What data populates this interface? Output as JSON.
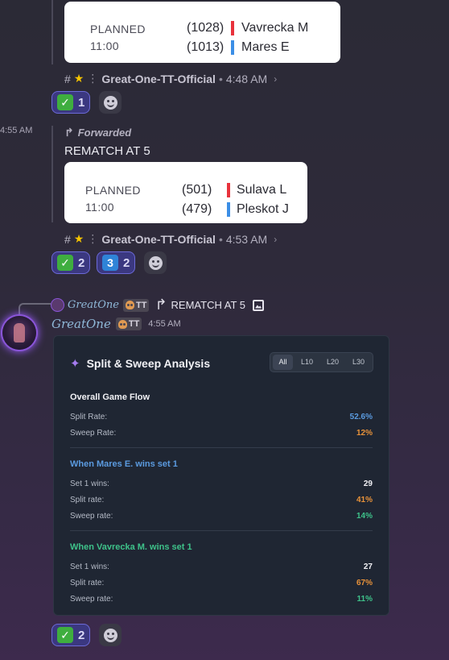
{
  "colors": {
    "red_bar": "#e8323c",
    "blue_bar": "#3b8ee6",
    "green_reaction": "#3fae3f",
    "blue_reaction": "#2f84d8",
    "accent_blue": "#5b9be0",
    "accent_orange": "#e8923a",
    "accent_green": "#3ec28a"
  },
  "messages": [
    {
      "match": {
        "status": "PLANNED",
        "time": "11:00",
        "p1_seed": "(1028)",
        "p1_name": "Vavrecka M",
        "p2_seed": "(1013)",
        "p2_name": "Mares E"
      },
      "channel_ref": {
        "channel": "Great-One-TT-Official",
        "timestamp": "4:48 AM"
      },
      "reactions": [
        {
          "emoji": "check-mark",
          "count": "1"
        }
      ]
    },
    {
      "side_time": "4:55 AM",
      "forwarded_label": "Forwarded",
      "text": "REMATCH AT 5",
      "match": {
        "status": "PLANNED",
        "time": "11:00",
        "p1_seed": "(501)",
        "p1_name": "Sulava L",
        "p2_seed": "(479)",
        "p2_name": "Pleskot J"
      },
      "channel_ref": {
        "channel": "Great-One-TT-Official",
        "timestamp": "4:53 AM"
      },
      "reactions": [
        {
          "emoji": "check-mark",
          "count": "2"
        },
        {
          "emoji": "keycap-three",
          "glyph": "3",
          "count": "2"
        }
      ]
    }
  ],
  "reply": {
    "author": "GreatOne",
    "badge": "TT",
    "text": "REMATCH AT 5"
  },
  "bot_message": {
    "author": "GreatOne",
    "badge": "TT",
    "timestamp": "4:55 AM",
    "reactions": [
      {
        "emoji": "check-mark",
        "count": "2"
      }
    ]
  },
  "analysis": {
    "title": "Split & Sweep Analysis",
    "filters": [
      "All",
      "L10",
      "L20",
      "L30"
    ],
    "active_filter": "All",
    "sections": [
      {
        "heading": "Overall Game Flow",
        "rows": [
          {
            "label": "Split Rate:",
            "value": "52.6%"
          },
          {
            "label": "Sweep Rate:",
            "value": "12%"
          }
        ]
      },
      {
        "heading": "When Mares E. wins set 1",
        "rows": [
          {
            "label": "Set 1 wins:",
            "value": "29"
          },
          {
            "label": "Split rate:",
            "value": "41%"
          },
          {
            "label": "Sweep rate:",
            "value": "14%"
          }
        ]
      },
      {
        "heading": "When Vavrecka M. wins set 1",
        "rows": [
          {
            "label": "Set 1 wins:",
            "value": "27"
          },
          {
            "label": "Split rate:",
            "value": "67%"
          },
          {
            "label": "Sweep rate:",
            "value": "11%"
          }
        ]
      }
    ]
  }
}
